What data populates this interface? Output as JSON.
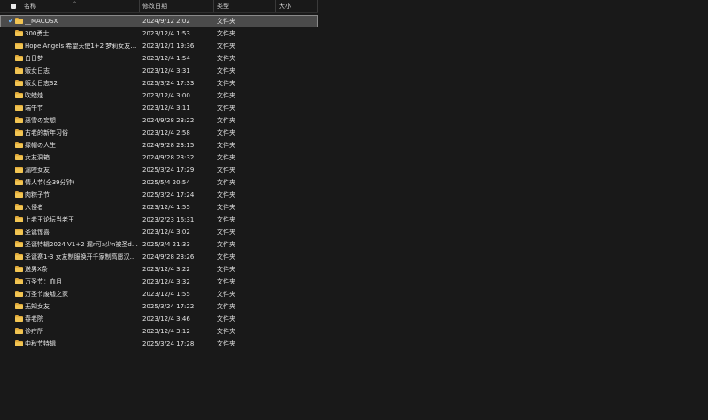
{
  "columns": {
    "name": "名称",
    "modified": "修改日期",
    "type": "类型",
    "size": "大小"
  },
  "files": [
    {
      "name": "__MACOSX",
      "modified": "2024/9/12 2:02",
      "type": "文件夹",
      "selected": true
    },
    {
      "name": "300勇士",
      "modified": "2023/12/4 1:53",
      "type": "文件夹"
    },
    {
      "name": "Hope Angels 希望天使1+2 梦莉女友哈街头...",
      "modified": "2023/12/1 19:36",
      "type": "文件夹"
    },
    {
      "name": "白日梦",
      "modified": "2023/12/4 1:54",
      "type": "文件夹"
    },
    {
      "name": "贩女日志",
      "modified": "2023/12/4 3:31",
      "type": "文件夹"
    },
    {
      "name": "贩女日志S2",
      "modified": "2025/3/24 17:33",
      "type": "文件夹"
    },
    {
      "name": "吹蜡烛",
      "modified": "2023/12/4 3:00",
      "type": "文件夹"
    },
    {
      "name": "端午节",
      "modified": "2023/12/4 3:11",
      "type": "文件夹"
    },
    {
      "name": "恶雪の妄想",
      "modified": "2024/9/28 23:22",
      "type": "文件夹"
    },
    {
      "name": "古老的新年习俗",
      "modified": "2023/12/4 2:58",
      "type": "文件夹"
    },
    {
      "name": "绿帽の人生",
      "modified": "2024/9/28 23:15",
      "type": "文件夹"
    },
    {
      "name": "女友洞箱",
      "modified": "2024/9/28 23:32",
      "type": "文件夹"
    },
    {
      "name": "漏咬女友",
      "modified": "2025/3/24 17:29",
      "type": "文件夹"
    },
    {
      "name": "情人节(全39分钟)",
      "modified": "2025/5/4 20:54",
      "type": "文件夹"
    },
    {
      "name": "肉粽子节",
      "modified": "2025/3/24 17:24",
      "type": "文件夹"
    },
    {
      "name": "入侵者",
      "modified": "2023/12/4 1:55",
      "type": "文件夹"
    },
    {
      "name": "上老王论坛当老王",
      "modified": "2023/2/23 16:31",
      "type": "文件夹"
    },
    {
      "name": "圣诞惊喜",
      "modified": "2023/12/4 3:02",
      "type": "文件夹"
    },
    {
      "name": "圣诞特辑2024 V1+2 漏r可a少n被圣dr衣人",
      "modified": "2025/3/4 21:33",
      "type": "文件夹"
    },
    {
      "name": "圣诞赛1-3 女友制服换开千家制高愿汉大满...",
      "modified": "2024/9/28 23:26",
      "type": "文件夹"
    },
    {
      "name": "送男X条",
      "modified": "2023/12/4 3:22",
      "type": "文件夹"
    },
    {
      "name": "万圣节：血月",
      "modified": "2023/12/4 3:32",
      "type": "文件夹"
    },
    {
      "name": "万圣节废墟之家",
      "modified": "2023/12/4 1:55",
      "type": "文件夹"
    },
    {
      "name": "无知女友",
      "modified": "2025/3/24 17:22",
      "type": "文件夹"
    },
    {
      "name": "春老院",
      "modified": "2023/12/4 3:46",
      "type": "文件夹"
    },
    {
      "name": "诊疗所",
      "modified": "2023/12/4 3:12",
      "type": "文件夹"
    },
    {
      "name": "中秋节特辑",
      "modified": "2025/3/24 17:28",
      "type": "文件夹"
    }
  ],
  "colors": {
    "background": "#191919",
    "selection": "#4b4b4b",
    "folder": "#f2c553",
    "folder_tab": "#e0a93a",
    "check_accent": "#6cb6ff"
  }
}
